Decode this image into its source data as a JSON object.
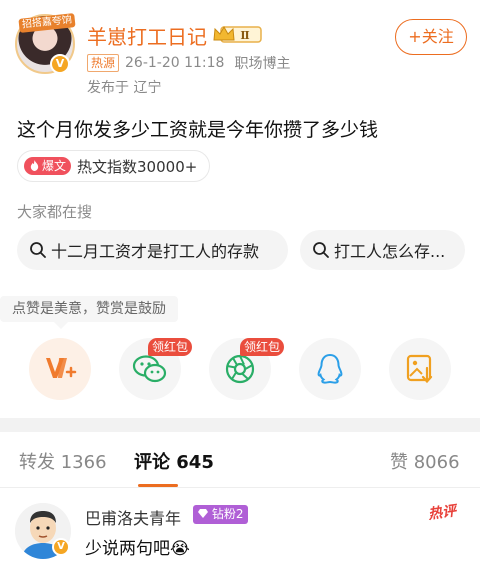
{
  "author": {
    "avatar_ribbon": "招搭嘉夸饷",
    "name": "羊崽打工日记",
    "level_badge": "Ⅱ",
    "source_tag": "热源",
    "date": "26-1-20 11:18",
    "title": "职场博主",
    "location": "发布于 辽宁",
    "follow_label": "+关注",
    "verify_icon": "v-verified-icon"
  },
  "post": {
    "text": "这个月你发多少工资就是今年你攒了多少钱",
    "hot_badge": "爆文",
    "hot_index": "热文指数30000+"
  },
  "search": {
    "title": "大家都在搜",
    "chips": [
      "十二月工资才是打工人的存款",
      "打工人怎么存..."
    ]
  },
  "share": {
    "tip": "点赞是美意，赞赏是鼓励",
    "red_packet_label": "领红包",
    "buttons": [
      "reward-icon",
      "wechat-icon",
      "moments-icon",
      "qq-icon",
      "save-image-icon"
    ]
  },
  "tabs": {
    "repost": "转发 1366",
    "comment": "评论 645",
    "like": "赞 8066"
  },
  "comment": {
    "user": "巴甫洛夫青年",
    "fan_badge": "钻粉2",
    "hot_label": "热评",
    "text": "少说两句吧😭"
  },
  "colors": {
    "accent": "#ec6d20",
    "hot_red": "#f0515d",
    "red_packet": "#ea4d3d",
    "fan_badge": "#b05fd6"
  }
}
